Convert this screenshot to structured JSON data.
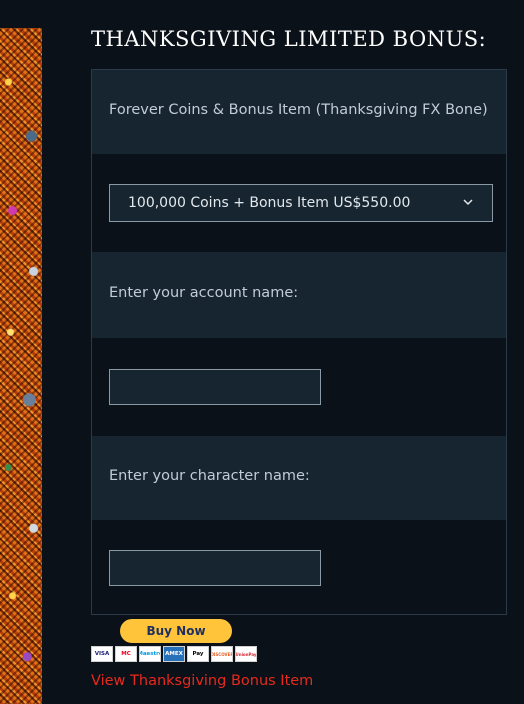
{
  "title": "THANKSGIVING LIMITED BONUS:",
  "product": {
    "label": "Forever Coins & Bonus Item (Thanksgiving FX Bone)",
    "selected_option": "100,000 Coins + Bonus Item US$550.00"
  },
  "account": {
    "label": "Enter your account name:",
    "value": ""
  },
  "character": {
    "label": "Enter your character name:",
    "value": ""
  },
  "paypal": {
    "button_label": "Buy Now",
    "cards": [
      "VISA",
      "MC",
      "Maestro",
      "AMEX",
      "Pay",
      "DISCOVER",
      "UnionPay"
    ]
  },
  "link": {
    "label": "View Thanksgiving Bonus Item"
  },
  "colors": {
    "background": "#0a1118",
    "row_alt": "#162530",
    "link": "#e8291e",
    "paypal": "#ffc439"
  }
}
